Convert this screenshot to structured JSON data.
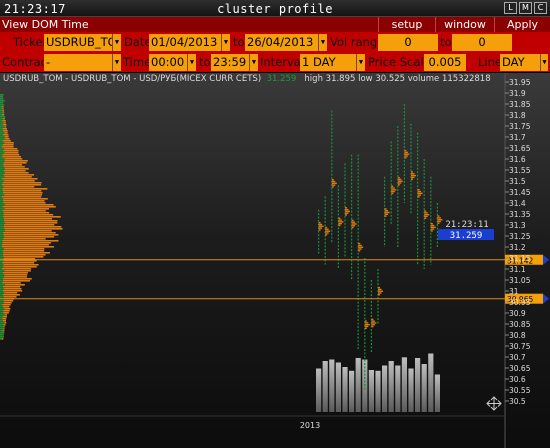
{
  "titlebar": {
    "clock": "21:23:17",
    "title": "cluster profile",
    "buttons": [
      "L",
      "M",
      "C"
    ]
  },
  "menubar": {
    "view_label": "View DOM Time Interval",
    "setup_label": "setup",
    "window_label": "window",
    "apply_label": "Apply"
  },
  "toolbar": {
    "ticker_label": "Ticker",
    "ticker_value": "USDRUB_TOM",
    "date_label": "Date",
    "date_from": "01/04/2013",
    "to_label": "to",
    "date_to": "26/04/2013",
    "vol_label": "Vol range",
    "vol_from": "0",
    "vol_to_label": "to",
    "vol_to": "0",
    "contract_label": "Contract",
    "contract_value": "-",
    "time_label": "Time",
    "time_from": "00:00",
    "time_to_label": "to",
    "time_to": "23:59",
    "interval_label": "Interval",
    "interval_value": "1 DAY",
    "scale_label": "Price Scale",
    "scale_value": "0.005",
    "line_label": "Line",
    "line_value": "DAY"
  },
  "chart_header": {
    "symbol": "USDRUB_TOM - USDRUB_TOM - USD/РУБ(MICEX CURR CETS)",
    "last": "31.259",
    "stats": "high 31.895  low 30.525  volume 115322818"
  },
  "colors": {
    "menu_bg": "#8b0000",
    "toolbar_bg": "#c00000",
    "field_bg": "#f5a00a",
    "profile": "#e07a10",
    "cluster_green": "#1a8f3a",
    "level_line": "#e08a10",
    "tag_blue": "#1a3fd0",
    "volume_bar": "#a6a6a6"
  },
  "chart_data": {
    "type": "bar",
    "y_axis_ticks": [
      "31.95",
      "31.9",
      "31.85",
      "31.8",
      "31.75",
      "31.7",
      "31.65",
      "31.6",
      "31.55",
      "31.5",
      "31.45",
      "31.4",
      "31.35",
      "31.3",
      "31.25",
      "31.2",
      "31.15",
      "31.1",
      "31.05",
      "31",
      "30.95",
      "30.9",
      "30.85",
      "30.8",
      "30.75",
      "30.7",
      "30.65",
      "30.6",
      "30.55",
      "30.5"
    ],
    "ylim": [
      30.5,
      31.95
    ],
    "x_axis_label": "2013",
    "crosshair": {
      "time": "21:23:11",
      "price": "31.259"
    },
    "levels": [
      {
        "label": "31.142",
        "value": 31.142
      },
      {
        "label": "30.965",
        "value": 30.965
      }
    ],
    "daily_ranges": [
      {
        "low": 31.17,
        "high": 31.37
      },
      {
        "low": 31.12,
        "high": 31.43
      },
      {
        "low": 31.22,
        "high": 31.82
      },
      {
        "low": 31.1,
        "high": 31.48
      },
      {
        "low": 31.15,
        "high": 31.58
      },
      {
        "low": 31.05,
        "high": 31.62
      },
      {
        "low": 30.73,
        "high": 31.62
      },
      {
        "low": 30.55,
        "high": 31.15
      },
      {
        "low": 30.72,
        "high": 31.05
      },
      {
        "low": 30.85,
        "high": 31.1
      },
      {
        "low": 31.2,
        "high": 31.52
      },
      {
        "low": 31.3,
        "high": 31.68
      },
      {
        "low": 31.2,
        "high": 31.75
      },
      {
        "low": 31.4,
        "high": 31.85
      },
      {
        "low": 31.35,
        "high": 31.76
      },
      {
        "low": 31.12,
        "high": 31.72
      },
      {
        "low": 31.1,
        "high": 31.6
      },
      {
        "low": 31.12,
        "high": 31.52
      },
      {
        "low": 31.2,
        "high": 31.4
      }
    ],
    "daily_volume_relative": [
      0.58,
      0.68,
      0.7,
      0.66,
      0.6,
      0.55,
      0.72,
      0.7,
      0.56,
      0.55,
      0.62,
      0.68,
      0.62,
      0.73,
      0.58,
      0.72,
      0.64,
      0.78,
      0.5
    ]
  }
}
